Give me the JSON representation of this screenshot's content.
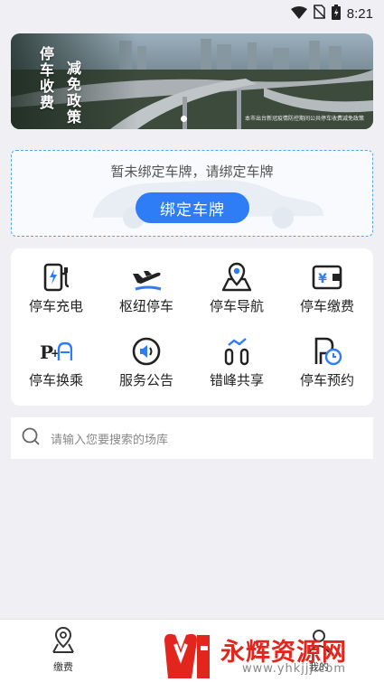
{
  "status_bar": {
    "time": "8:21",
    "icons": [
      "wifi-icon",
      "no-sim-icon",
      "battery-charging-icon"
    ]
  },
  "banner": {
    "title_line1": "停车收费",
    "title_line2": "减免政策",
    "caption": "本市出台新冠疫情防控期间公共停车收费减免政策",
    "active_slide": 1
  },
  "bind_card": {
    "hint": "暂未绑定车牌，请绑定车牌",
    "button_label": "绑定车牌"
  },
  "services": [
    {
      "label": "停车充电",
      "icon": "ev-charger-icon"
    },
    {
      "label": "枢纽停车",
      "icon": "airplane-icon"
    },
    {
      "label": "停车导航",
      "icon": "map-pin-icon"
    },
    {
      "label": "停车缴费",
      "icon": "wallet-icon"
    },
    {
      "label": "停车换乘",
      "icon": "park-and-ride-icon"
    },
    {
      "label": "服务公告",
      "icon": "speaker-icon"
    },
    {
      "label": "错峰共享",
      "icon": "share-bars-icon"
    },
    {
      "label": "停车预约",
      "icon": "parking-clock-icon"
    }
  ],
  "search": {
    "placeholder": "请输入您要搜索的场库"
  },
  "tab_bar": {
    "tabs": [
      {
        "label": "缴费",
        "icon": "location-pin-icon"
      },
      {
        "label": "我的",
        "icon": "user-icon"
      }
    ]
  },
  "watermark": {
    "text": "永辉资源网",
    "url": "www.yhkjjj.com"
  },
  "colors": {
    "accent": "#2f7df6",
    "dashed_border": "#5aa3e6",
    "background": "#efeff4",
    "watermark_red": "#e2261d"
  }
}
